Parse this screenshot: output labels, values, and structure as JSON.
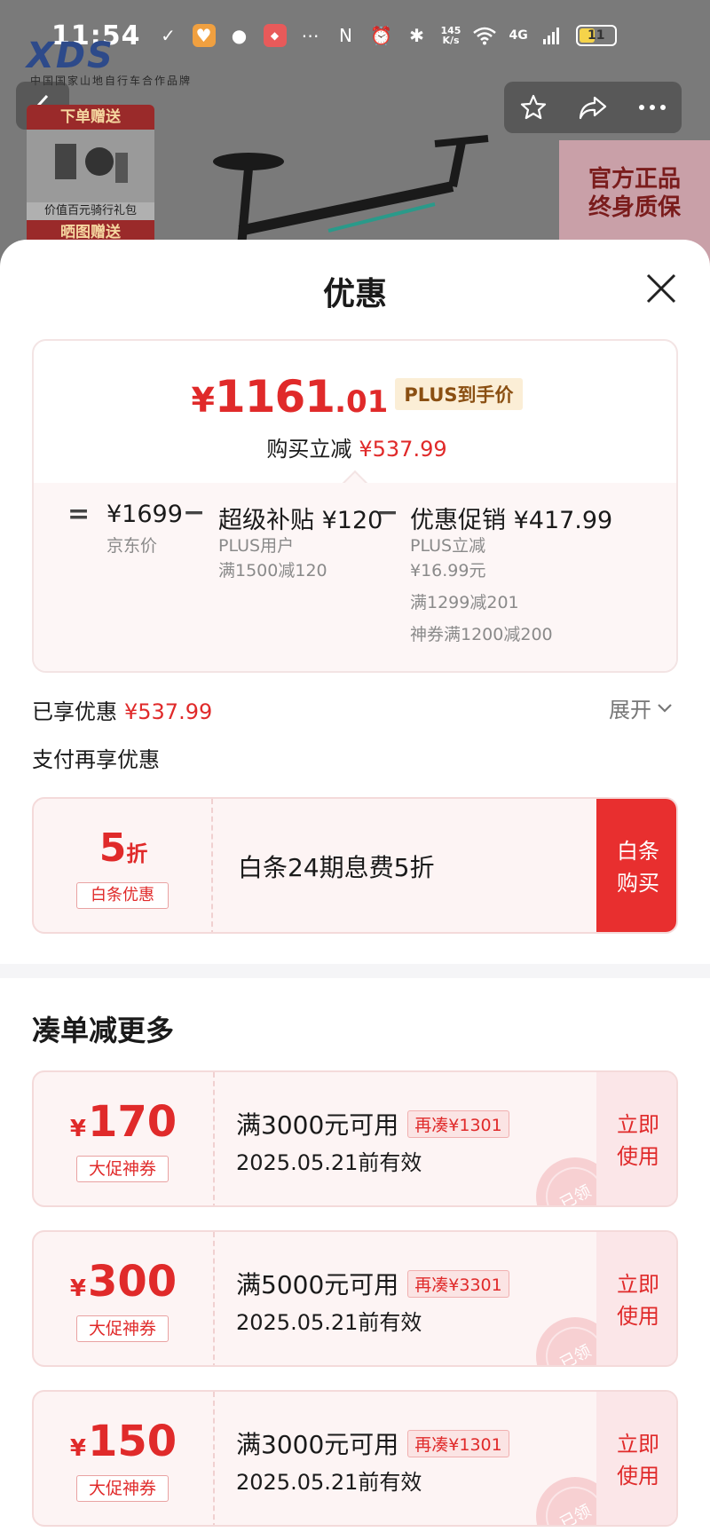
{
  "status_bar": {
    "time": "11:54",
    "speed_top": "145",
    "speed_bottom": "K/s",
    "network": "4G",
    "battery": "11"
  },
  "background": {
    "brand_sub": "中国国家山地自行车合作品牌",
    "gift_header": "下单赠送",
    "gift_label": "价值百元骑行礼包",
    "gift_header_2": "晒图赠送",
    "guarantee_line1": "官方正品",
    "guarantee_line2": "终身质保"
  },
  "sheet": {
    "title": "优惠",
    "price": {
      "yen": "¥",
      "final_int": "1161",
      "final_dec": ".01",
      "plus_tag": "PLUS到手价",
      "instant_label": "购买立减",
      "instant_value": "¥537.99",
      "breakdown": {
        "eq": "=",
        "jd_value": "¥1699",
        "jd_label": "京东价",
        "minus1": "−",
        "subsidy_main": "超级补贴 ¥120",
        "subsidy_line1": "PLUS用户",
        "subsidy_line2": "满1500减120",
        "minus2": "−",
        "promo_main": "优惠促销 ¥417.99",
        "promo_line1": "PLUS立减",
        "promo_line2": "¥16.99元",
        "promo_line3": "满1299减201",
        "promo_line4": "神券满1200减200"
      }
    },
    "enjoyed_label": "已享优惠",
    "enjoyed_value": "¥537.99",
    "expand_label": "展开",
    "pay_more_label": "支付再享优惠",
    "baitiao": {
      "discount_num": "5",
      "discount_unit": "折",
      "tag": "白条优惠",
      "desc": "白条24期息费5折",
      "button_line1": "白条",
      "button_line2": "购买"
    },
    "section_title": "凑单减更多",
    "coupons": [
      {
        "yen": "¥",
        "amount": "170",
        "tag": "大促神券",
        "condition": "满3000元可用",
        "extra": "再凑¥1301",
        "valid": "2025.05.21前有效",
        "use_line1": "立即",
        "use_line2": "使用",
        "stamp": "已领"
      },
      {
        "yen": "¥",
        "amount": "300",
        "tag": "大促神券",
        "condition": "满5000元可用",
        "extra": "再凑¥3301",
        "valid": "2025.05.21前有效",
        "use_line1": "立即",
        "use_line2": "使用",
        "stamp": "已领"
      },
      {
        "yen": "¥",
        "amount": "150",
        "tag": "大促神券",
        "condition": "满3000元可用",
        "extra": "再凑¥1301",
        "valid": "2025.05.21前有效",
        "use_line1": "立即",
        "use_line2": "使用",
        "stamp": "已领"
      }
    ]
  },
  "colors": {
    "accent_red": "#e02a2a",
    "plus_gold": "#8a4f12",
    "card_bg": "#fdf4f4"
  }
}
